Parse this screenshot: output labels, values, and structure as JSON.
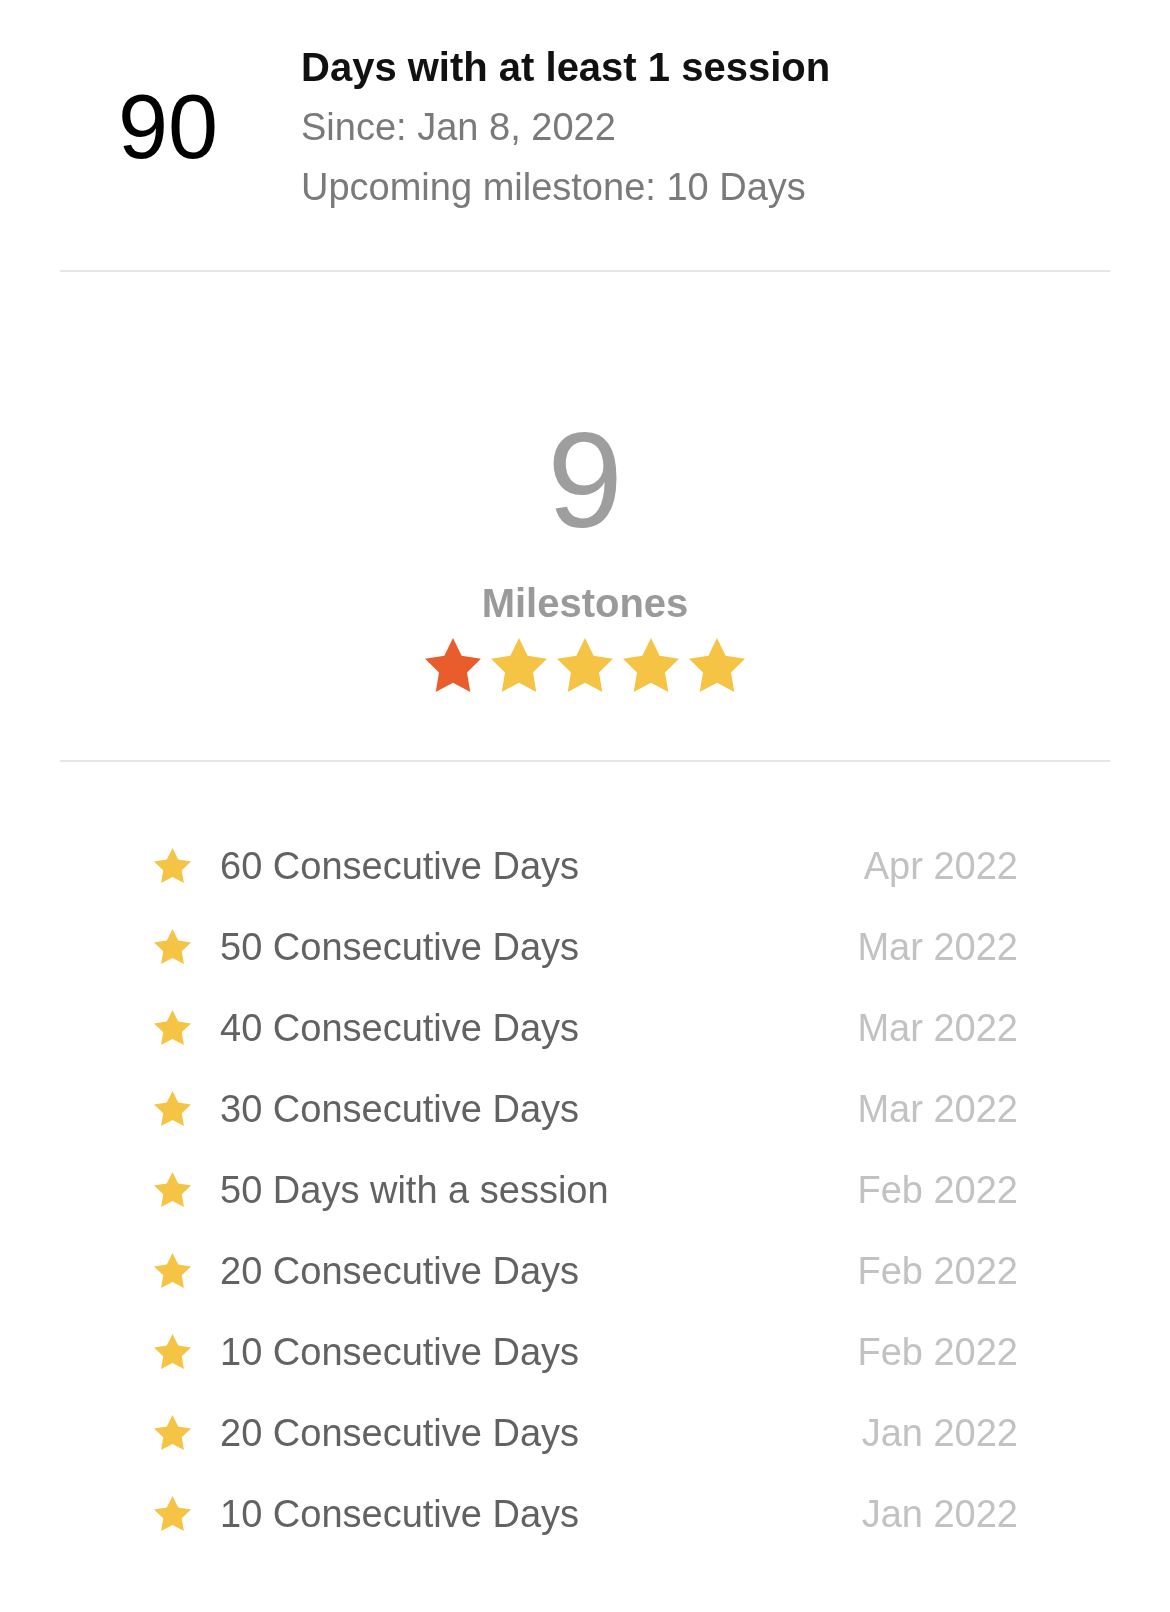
{
  "summary": {
    "count": "90",
    "title": "Days with at least 1 session",
    "since": "Since: Jan 8, 2022",
    "upcoming": "Upcoming milestone: 10 Days"
  },
  "milestones": {
    "count": "9",
    "label": "Milestones",
    "stars": [
      {
        "color": "#e85d2b"
      },
      {
        "color": "#f6c445"
      },
      {
        "color": "#f6c445"
      },
      {
        "color": "#f6c445"
      },
      {
        "color": "#f6c445"
      }
    ]
  },
  "achievements": [
    {
      "label": "60 Consecutive Days",
      "date": "Apr 2022"
    },
    {
      "label": "50 Consecutive Days",
      "date": "Mar 2022"
    },
    {
      "label": "40 Consecutive Days",
      "date": "Mar 2022"
    },
    {
      "label": "30 Consecutive Days",
      "date": "Mar 2022"
    },
    {
      "label": "50 Days with a session",
      "date": "Feb 2022"
    },
    {
      "label": "20 Consecutive Days",
      "date": "Feb 2022"
    },
    {
      "label": "10 Consecutive Days",
      "date": "Feb 2022"
    },
    {
      "label": "20 Consecutive Days",
      "date": "Jan 2022"
    },
    {
      "label": "10 Consecutive Days",
      "date": "Jan 2022"
    }
  ]
}
